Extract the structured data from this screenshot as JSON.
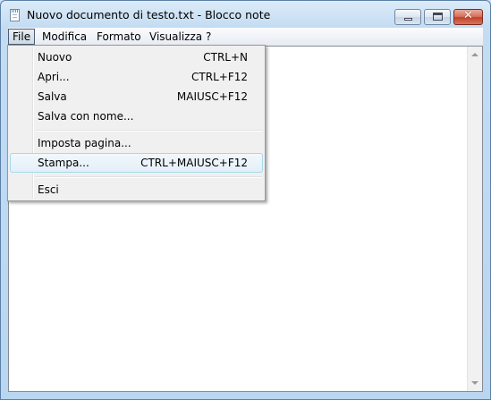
{
  "window": {
    "title": "Nuovo documento di testo.txt - Blocco note",
    "minimize_icon": "minimize-icon",
    "maximize_icon": "maximize-icon",
    "close_icon": "close-icon",
    "close_glyph": "✕"
  },
  "menubar": {
    "items": [
      "File",
      "Modifica",
      "Formato",
      "Visualizza",
      "?"
    ]
  },
  "file_menu": {
    "items": [
      {
        "label": "Nuovo",
        "shortcut": "CTRL+N"
      },
      {
        "label": "Apri...",
        "shortcut": "CTRL+F12"
      },
      {
        "label": "Salva",
        "shortcut": "MAIUSC+F12"
      },
      {
        "label": "Salva con nome...",
        "shortcut": ""
      },
      {
        "label": "Imposta pagina...",
        "shortcut": ""
      },
      {
        "label": "Stampa...",
        "shortcut": "CTRL+MAIUSC+F12"
      },
      {
        "label": "Esci",
        "shortcut": ""
      }
    ],
    "highlighted": "Stampa..."
  },
  "editor": {
    "content": ""
  },
  "colors": {
    "title_bar": "#c3dcf2",
    "menu_highlight_border": "#a8d8eb",
    "close_button": "#c0412a"
  }
}
